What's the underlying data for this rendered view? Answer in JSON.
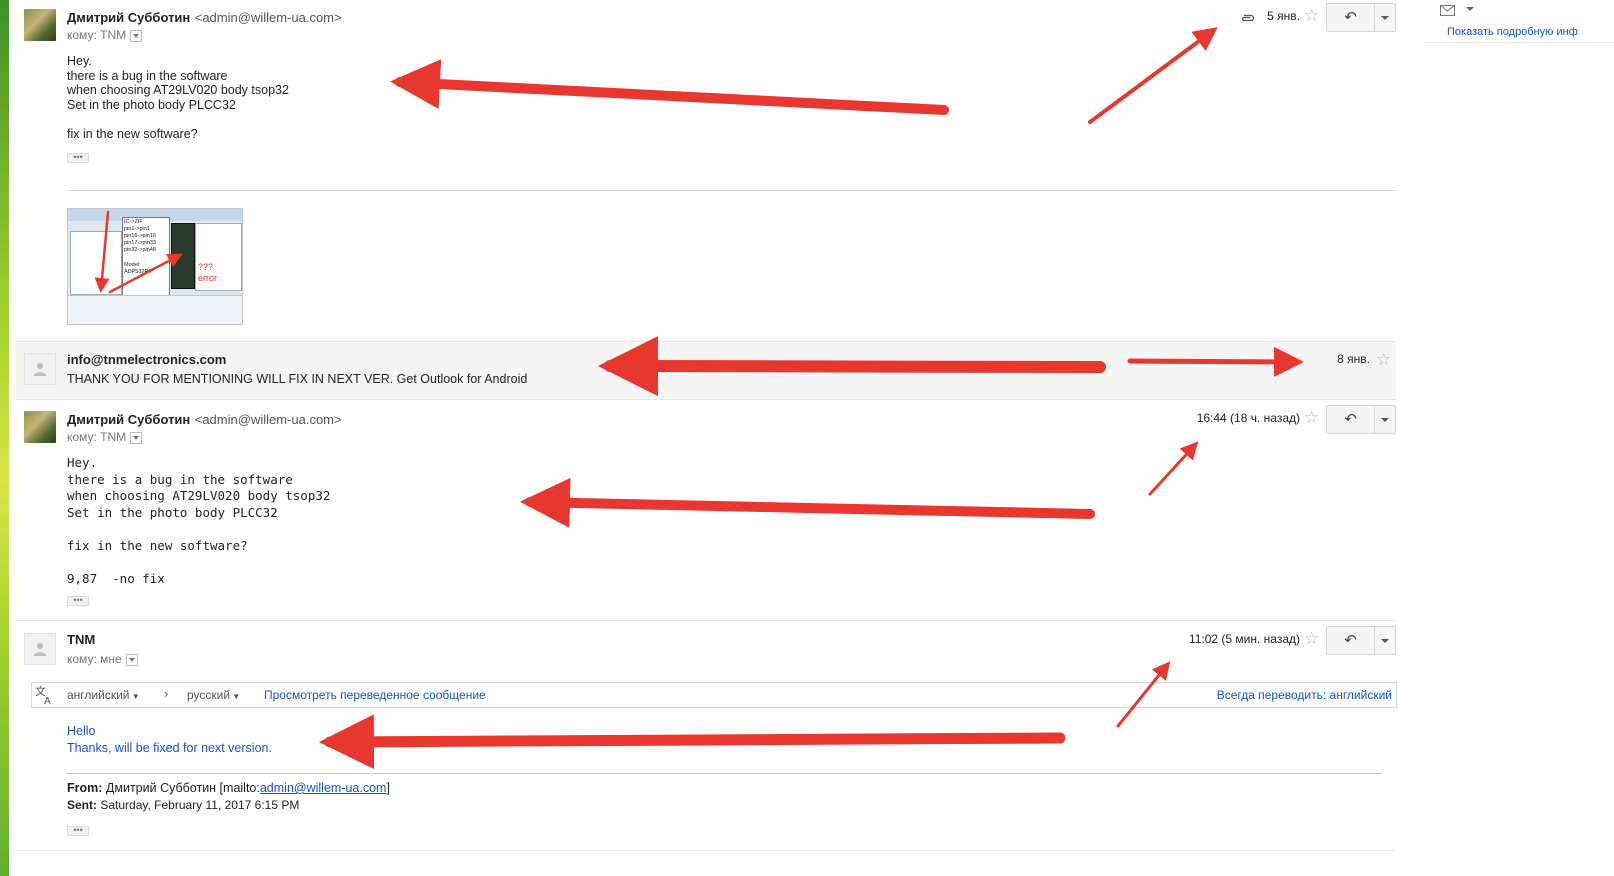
{
  "messages": [
    {
      "sender": "Дмитрий Субботин",
      "address": "<admin@willem-ua.com>",
      "to_prefix": "кому:",
      "to": "TNM",
      "date": "5 янв.",
      "body": "Hey.\nthere is a bug in the software\nwhen choosing AT29LV020 body tsop32\nSet in the photo body PLCC32\n\nfix in the new software?"
    },
    {
      "sender": "info@tnmelectronics.com",
      "snippet": "THANK YOU FOR MENTIONING WILL FIX IN NEXT VER. Get Outlook for Android",
      "date": "8 янв."
    },
    {
      "sender": "Дмитрий Субботин",
      "address": "<admin@willem-ua.com>",
      "to_prefix": "кому:",
      "to": "TNM",
      "date": "16:44 (18 ч. назад)",
      "body": "Hey.\nthere is a bug in the software\nwhen choosing AT29LV020 body tsop32\nSet in the photo body PLCC32\n\nfix in the new software?\n\n9,87  -no fix"
    },
    {
      "sender": "TNM",
      "to_prefix": "кому:",
      "to": "мне",
      "date": "11:02 (5 мин. назад)",
      "translate": {
        "from_lang": "английский",
        "to_lang": "русский",
        "view_translated": "Просмотреть переведенное сообщение",
        "always_translate": "Всегда переводить: английский"
      },
      "body_line1": "Hello",
      "body_line2": "Thanks, will be fixed for next version.",
      "quote": {
        "from_label": "From:",
        "from_name": "Дмитрий Субботин [mailto:",
        "from_link": "admin@willem-ua.com",
        "from_close": "]",
        "sent_label": "Sent:",
        "sent_value": "Saturday, February 11, 2017 6:15 PM"
      }
    }
  ],
  "dots_label": "•••",
  "reply_icon": "↶",
  "star_icon": "☆",
  "attachment_thumb": {
    "lines": [
      "IC->ZIF",
      "pin1->pin1",
      "pin16->pin16",
      "pin17->pin33",
      "pin32->pin48"
    ],
    "error_q": "???",
    "error": "error",
    "model": "Model: ADP532P4"
  },
  "sidebar": {
    "mail_icon": "envelope-icon",
    "show_more": "Показать подробную инф"
  },
  "colors": {
    "arrow": "#e8372e",
    "link": "#1155cc",
    "collapsed_bg": "#f5f5f5"
  }
}
